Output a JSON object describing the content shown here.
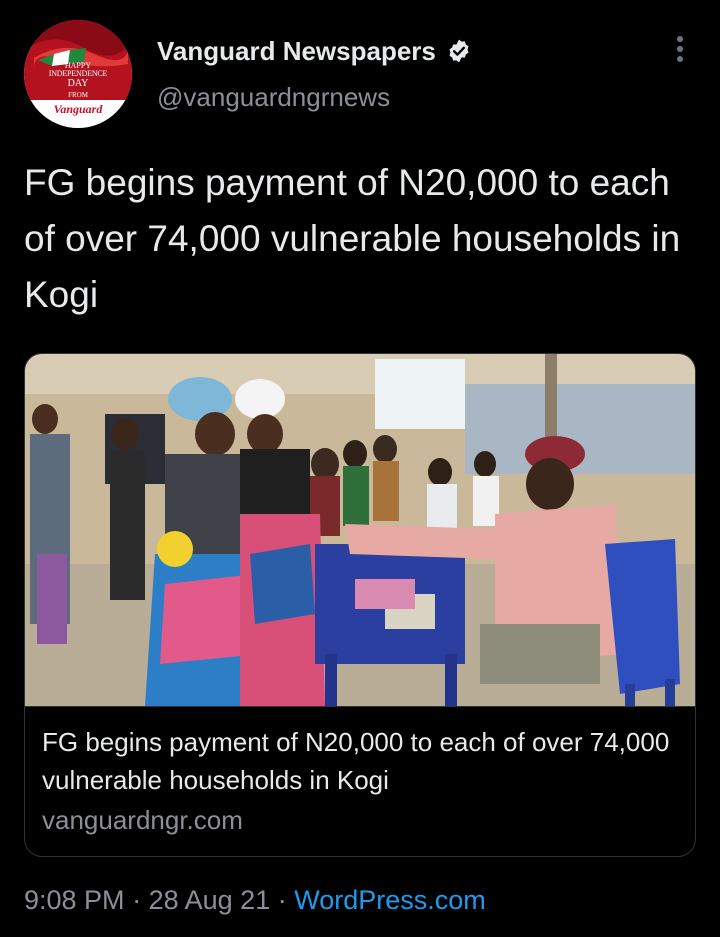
{
  "header": {
    "display_name": "Vanguard Newspapers",
    "handle": "@vanguardngrnews",
    "verified_icon": "verified-badge-icon",
    "more_icon": "more-vertical-icon",
    "avatar_text": {
      "line1": "HAPPY",
      "line2": "INDEPENDENCE",
      "line3": "DAY",
      "line4": "FROM",
      "line5": "Vanguard"
    }
  },
  "tweet": {
    "text": "FG begins payment of N20,000 to each of over 74,000 vulnerable households in Kogi"
  },
  "card": {
    "image_description_icon": "news-photo",
    "title": "FG begins payment of N20,000 to each of over 74,000 vulnerable households in Kogi",
    "domain": "vanguardngr.com"
  },
  "footer": {
    "time": "9:08 PM",
    "separator": "·",
    "date": "28 Aug 21",
    "source": "WordPress.com"
  },
  "colors": {
    "background": "#000000",
    "text_primary": "#e7e9ea",
    "text_secondary": "#8b9096",
    "link": "#1d9bf0",
    "border": "#2f3336",
    "brand_red": "#c8102e"
  }
}
